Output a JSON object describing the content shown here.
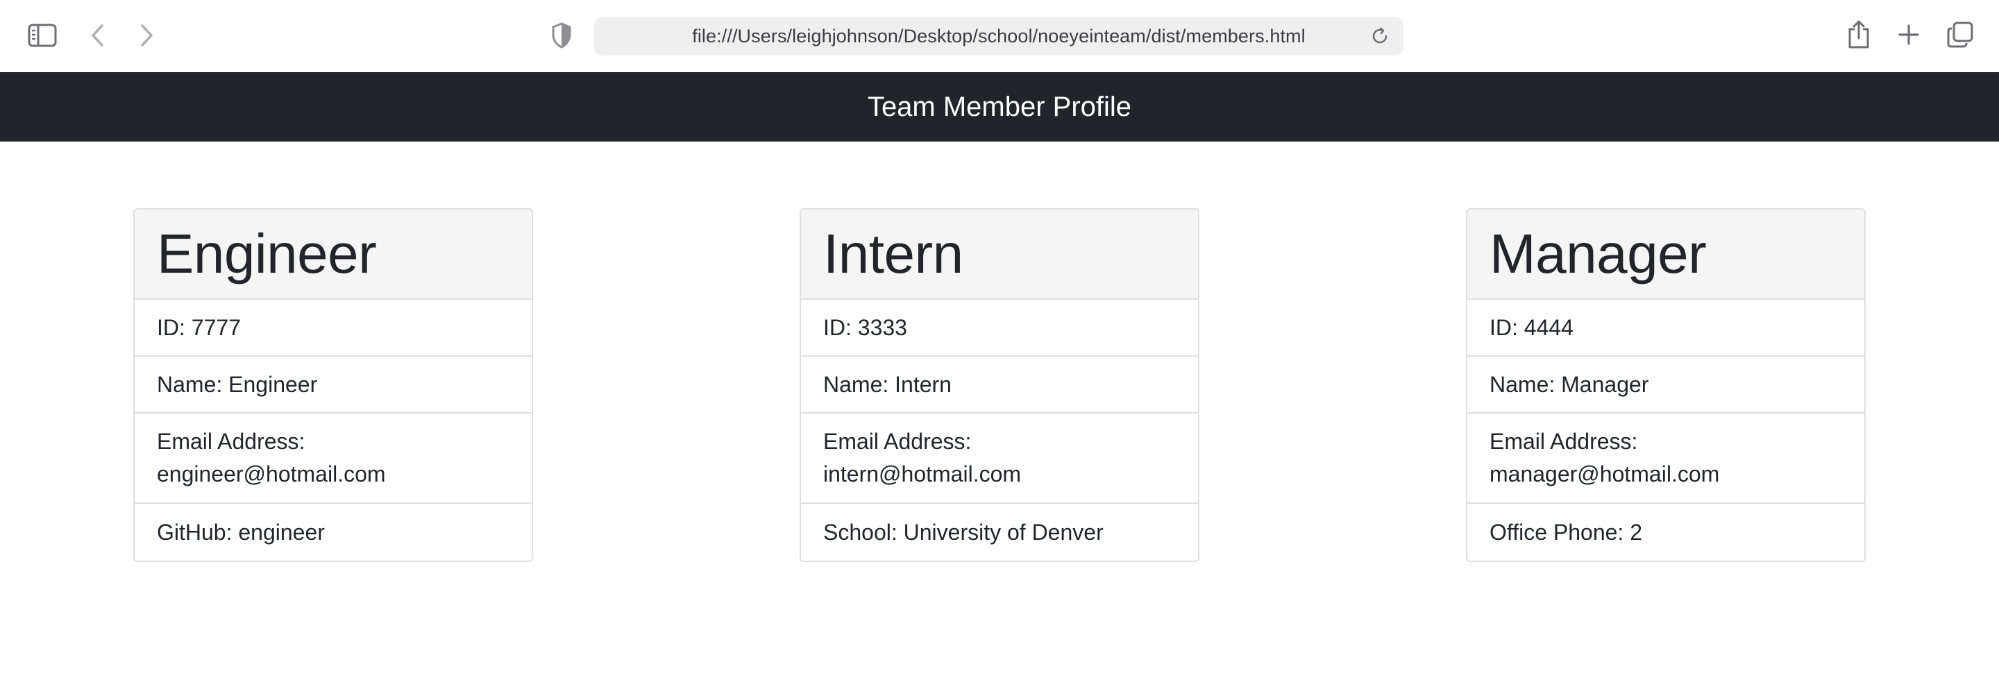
{
  "browser": {
    "url": "file:///Users/leighjohnson/Desktop/school/noeyeinteam/dist/members.html"
  },
  "header": {
    "title": "Team Member Profile"
  },
  "cards": [
    {
      "role": "Engineer",
      "id": "ID: 7777",
      "name": "Name: Engineer",
      "email_label": "Email Address:",
      "email": "engineer@hotmail.com",
      "extra": "GitHub: engineer"
    },
    {
      "role": "Intern",
      "id": "ID: 3333",
      "name": "Name: Intern",
      "email_label": "Email Address:",
      "email": "intern@hotmail.com",
      "extra": "School: University of Denver"
    },
    {
      "role": "Manager",
      "id": "ID: 4444",
      "name": "Name: Manager",
      "email_label": "Email Address:",
      "email": "manager@hotmail.com",
      "extra": "Office Phone: 2"
    }
  ],
  "colors": {
    "header_bg": "#212529",
    "card_header_bg": "#f5f5f5",
    "border": "#dfdfdf",
    "text": "#212529"
  },
  "icons": [
    "sidebar-icon",
    "back-icon",
    "forward-icon",
    "privacy-shield-icon",
    "reload-icon",
    "share-icon",
    "new-tab-icon",
    "tab-overview-icon"
  ]
}
